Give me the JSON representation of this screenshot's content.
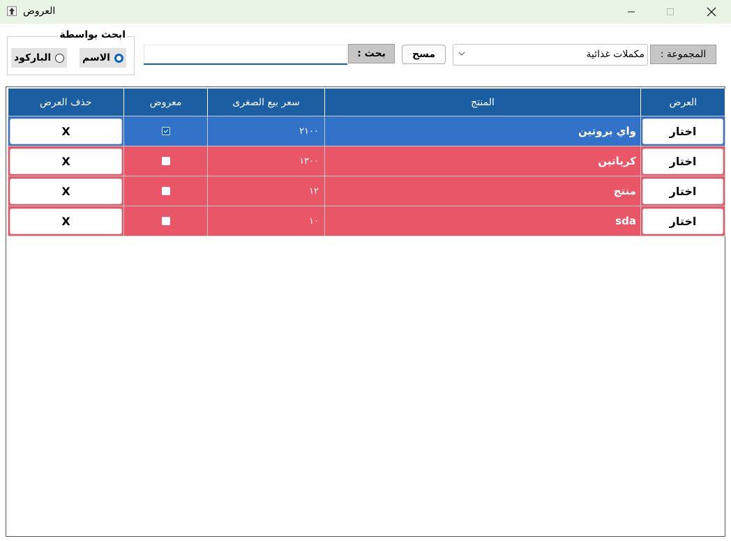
{
  "window": {
    "title": "العروض",
    "icon": "app-icon",
    "controls": [
      "minimize-icon",
      "maximize-icon",
      "close-icon"
    ]
  },
  "search_by": {
    "legend": "ابحث بواسطة",
    "options": [
      {
        "label": "الاسم",
        "checked": true
      },
      {
        "label": "الباركود",
        "checked": false
      }
    ]
  },
  "search": {
    "label": "بحث :",
    "value": "",
    "clear_label": "مسح"
  },
  "group": {
    "label": "المجموعة :",
    "selected": "مكملات غذائية"
  },
  "table": {
    "headers": {
      "offer": "العرض",
      "product": "المنتج",
      "price": "سعر بيع الصغرى",
      "displayed": "معروض",
      "delete": "حذف العرض"
    },
    "rows": [
      {
        "offer_button": "اختار",
        "product": "واي بروتين",
        "price": "٢١٠٠",
        "displayed": true,
        "delete_button": "X",
        "selected": true
      },
      {
        "offer_button": "اختار",
        "product": "كرياتين",
        "price": "١٣٠٠",
        "displayed": false,
        "delete_button": "X",
        "selected": false
      },
      {
        "offer_button": "اختار",
        "product": "منتج",
        "price": "١٢",
        "displayed": false,
        "delete_button": "X",
        "selected": false
      },
      {
        "offer_button": "اختار",
        "product": "sda",
        "price": "١٠",
        "displayed": false,
        "delete_button": "X",
        "selected": false
      }
    ]
  },
  "colors": {
    "header": "#1b5ea2",
    "selected_row": "#3273c9",
    "row_highlight": "#e85667",
    "titlebar": "#e8f5e4"
  }
}
